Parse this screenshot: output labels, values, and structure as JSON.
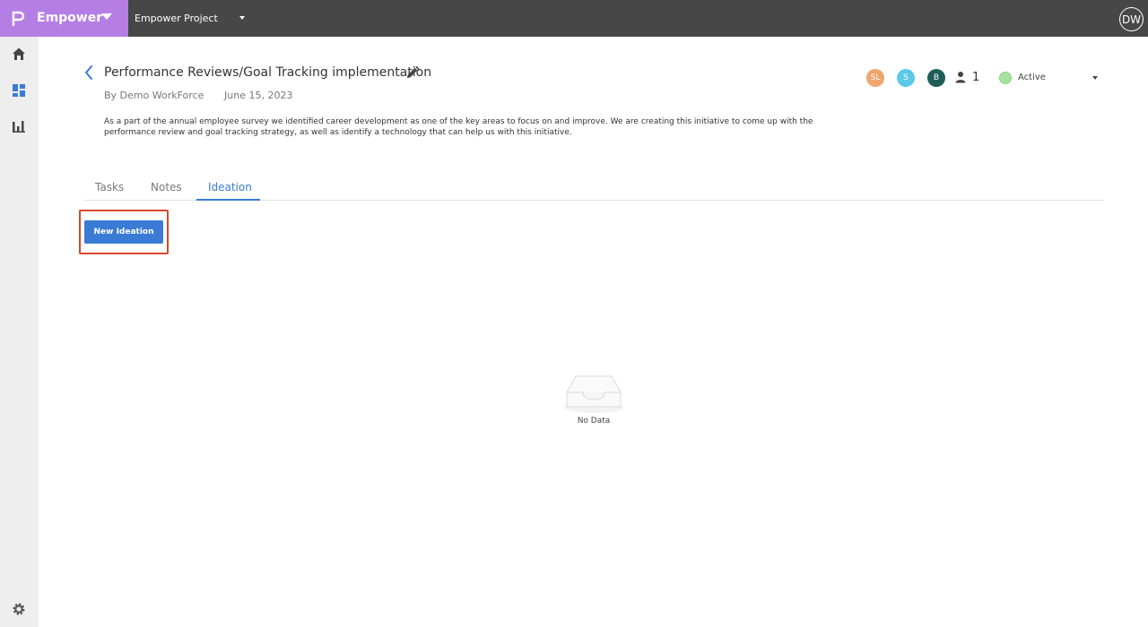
{
  "app": {
    "brand_name": "Empower",
    "project_name": "Empower Project",
    "user_initials": "DW"
  },
  "sidebar": {
    "items": [
      {
        "icon": "home-icon"
      },
      {
        "icon": "dashboard-icon"
      },
      {
        "icon": "bar-chart-icon"
      },
      {
        "icon": "gear-icon"
      }
    ]
  },
  "initiative": {
    "title": "Performance Reviews/Goal Tracking implementation",
    "byline": "By Demo WorkForce",
    "date": "June 15, 2023",
    "description": "As a part of the annual employee survey we identified career development as one of the key areas to focus on and improve. We are creating this initiative to come up with the performance review and goal tracking strategy, as well as identify a technology that can help us with this initiative."
  },
  "members": {
    "avatars": [
      {
        "initials": "SL",
        "color": "#f0a46e"
      },
      {
        "initials": "S",
        "color": "#5dc9e8"
      },
      {
        "initials": "B",
        "color": "#1d5e5a"
      }
    ],
    "count": "1"
  },
  "status": {
    "label": "Active",
    "color": "#a8e29f"
  },
  "tabs": [
    {
      "label": "Tasks"
    },
    {
      "label": "Notes"
    },
    {
      "label": "Ideation"
    }
  ],
  "active_tab": "Ideation",
  "ideation": {
    "new_button_label": "New Ideation",
    "empty_text": "No Data"
  },
  "colors": {
    "accent": "#3a7bd5",
    "brand": "#b57ee5",
    "topbar": "#474747",
    "highlight": "#d9472b"
  }
}
